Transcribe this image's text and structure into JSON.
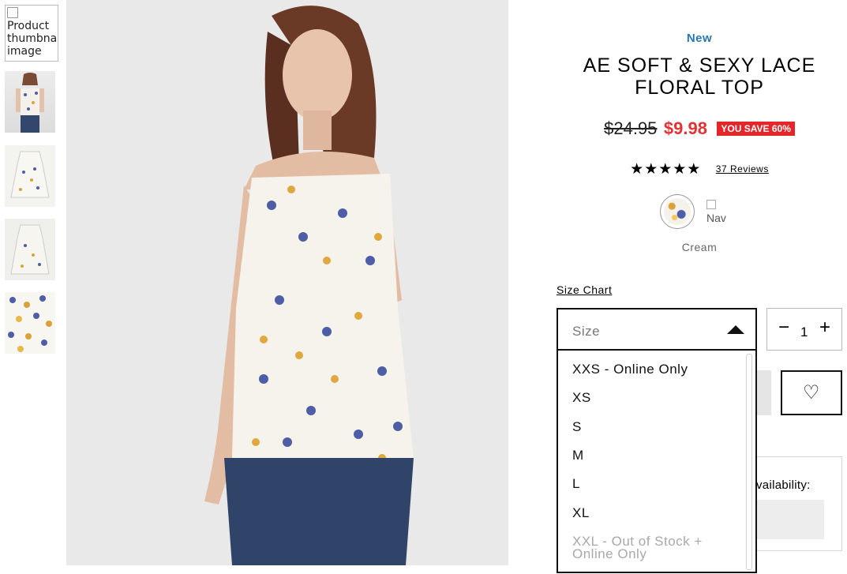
{
  "thumbnails": [
    {
      "alt": "Product thumbnail image",
      "broken": true
    },
    {
      "alt": "back view"
    },
    {
      "alt": "flat front"
    },
    {
      "alt": "flat back"
    },
    {
      "alt": "fabric detail"
    }
  ],
  "product": {
    "badge": "New",
    "title": "AE SOFT & SEXY LACE FLORAL TOP",
    "price_original": "$24.95",
    "price_sale": "$9.98",
    "save_label": "YOU SAVE 60%",
    "stars": "★★★★★",
    "reviews_label": "37 Reviews",
    "rating": 5,
    "color_name": "Cream",
    "alt_swatch_text": "Nav"
  },
  "size": {
    "size_chart_label": "Size Chart",
    "placeholder": "Size",
    "options": [
      {
        "label": "XXS - Online Only",
        "disabled": false
      },
      {
        "label": "XS",
        "disabled": false
      },
      {
        "label": "S",
        "disabled": false
      },
      {
        "label": "M",
        "disabled": false
      },
      {
        "label": "L",
        "disabled": false
      },
      {
        "label": "XL",
        "disabled": false
      },
      {
        "label": "XXL - Out of Stock + Online Only",
        "disabled": true
      }
    ]
  },
  "quantity": {
    "minus": "−",
    "value": "1",
    "plus": "+"
  },
  "favorite": {
    "icon": "♡"
  },
  "availability": {
    "label": "vailability:"
  },
  "colors": {
    "accent_blue": "#2b74b4",
    "sale_red": "#e03434",
    "badge_red": "#e4262b"
  }
}
